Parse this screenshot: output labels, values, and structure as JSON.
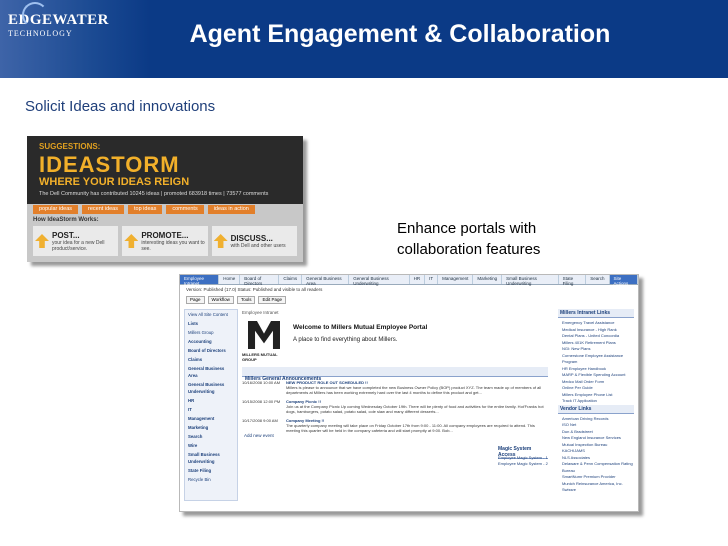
{
  "header": {
    "logo_line1": "EDGEWATER",
    "logo_line2": "TECHNOLOGY",
    "title": "Agent Engagement & Collaboration"
  },
  "subtitle": "Solicit Ideas and innovations",
  "enhance": {
    "line1": "Enhance portals with",
    "line2": "collaboration features"
  },
  "ideastorm": {
    "suggestions": "SUGGESTIONS:",
    "word": "IDEASTORM",
    "tagline": "WHERE YOUR IDEAS REIGN",
    "stats": "The Dell Community has contributed 10245 ideas | promoted 683918 times | 73577 comments",
    "tabs": [
      "popular ideas",
      "recent ideas",
      "top ideas",
      "comments",
      "ideas in action"
    ],
    "how": "How IdeaStorm Works:",
    "steps": [
      {
        "title": "POST...",
        "desc": "your idea for a new Dell product/service."
      },
      {
        "title": "PROMOTE...",
        "desc": "interesting ideas you want to see."
      },
      {
        "title": "DISCUSS...",
        "desc": "with Dell and other users"
      }
    ]
  },
  "portal": {
    "nav": [
      "Employee Intranet",
      "Home",
      "Board of Directors",
      "Claims",
      "General Business Area",
      "General Business Underwriting",
      "HR",
      "IT",
      "Management",
      "Marketing",
      "Small Business Underwriting",
      "State Filing",
      "Search",
      "Site Actions"
    ],
    "version": "Version: Published (17.0)   Status: Published and visible to all readers",
    "toolbar": [
      "Page",
      "Workflow",
      "Tools",
      "Edit Page"
    ],
    "left_nav": [
      "View All Site Content",
      "Lists",
      "Millers Group",
      "Accounting",
      "Board of Directors",
      "Claims",
      "General Business Area",
      "General Business Underwriting",
      "HR",
      "IT",
      "Management",
      "Marketing",
      "Search",
      "Wire",
      "Small Business Underwriting",
      "State Filing",
      "Recycle Bin"
    ],
    "crumb": "Employee Intranet",
    "logo_group": "MILLERS MUTUAL GROUP",
    "welcome": "Welcome to Millers Mutual Employee Portal",
    "place": "A place to find everything about Millers.",
    "announcements_title": "Millers General Announcements",
    "announcements": [
      {
        "date": "10/16/2008 10:00 AM",
        "title": "NEW PRODUCT ROLE OUT SCHEDULED !!",
        "text": "Millers is please to announce that we have completed the new Business Owner Policy (BOP) product XYZ. The team made up of members of all departments at Millers has been working extremely hard over the last 4 months to define this product and get..."
      },
      {
        "date": "10/15/2008 12:00 PM",
        "title": "Company Picnic !!",
        "text": "Join us at the Company Picnic Up coming Wednesday October 19th. There will be plenty of food and activities for the entire family. Hot'Franks hot dogs, hamburgers, potato salad, potato salad, cole slaw and many different desserts..."
      },
      {
        "date": "10/17/2008 9:00 AM",
        "title": "Company Meeting !!",
        "text": "The quarterly company meeting will take place on Friday October 17th from 9:00 - 11:00. All company employees are required to attend. This meeting this quarter will be held in the company cafeteria and will start promptly at 9:00. Bob..."
      }
    ],
    "add_new": "Add new event",
    "magic_title": "Magic System Access",
    "magic": [
      "Employee Magic System - 1",
      "Employee Magic System - 2"
    ],
    "intranet_title": "Millers Intranet Links",
    "intranet_links": [
      "Emergency Travel Assistance",
      "Medical Insurance - High Rank",
      "Dental Plans - United Concordia",
      "Millers 401K Retirement Plans",
      "NGI: New Plans",
      "Cornerstone Employee Assistance Program",
      "HR Employee Handbook",
      "MARP & Flexible Spending Account",
      "Medco Mail Order Form",
      "Online Per Guide",
      "Millers Employee Phone List",
      "Track IT Application"
    ],
    "vendor_title": "Vendor Links",
    "vendor_links": [
      "American Driving Records",
      "ISO Net",
      "Dun & Bradstreet",
      "New England Insurance Services",
      "Mutual Inspection Bureau",
      "KACHIJAMS",
      "NLS Associates",
      "Delaware & Penn Compensation Rating Bureau",
      "SmartNumr Premium Provider",
      "Munich Reinsurance America, Inc.",
      "Swissre"
    ]
  }
}
